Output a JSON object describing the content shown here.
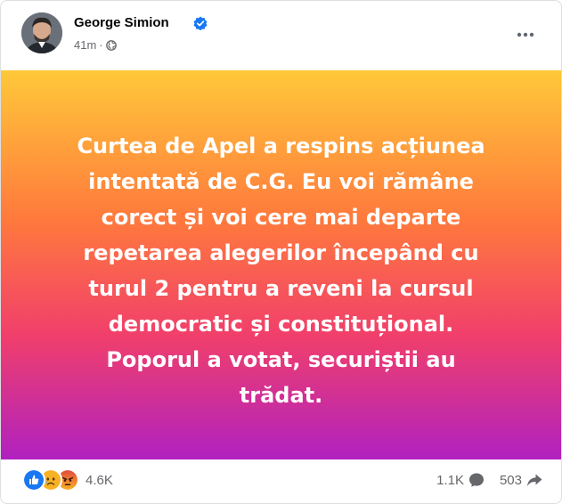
{
  "post": {
    "author": "George Simion",
    "verified": true,
    "time": "41m",
    "separator": "·",
    "privacy_icon": "globe-icon",
    "more_icon": "more-options-icon"
  },
  "banner": {
    "text": "Curtea de Apel a respins acțiunea intentată de C.G. Eu voi rămâne corect și voi cere mai departe repetarea alegerilor începând cu turul 2 pentru a reveni la cursul democratic și constituțional. Poporul a votat, securiștii au trădat.",
    "gradient": [
      "#ffc83a",
      "#ff7a3c",
      "#f13f6b",
      "#b021c0"
    ]
  },
  "footer": {
    "reactions": [
      "like-reaction-icon",
      "sad-reaction-icon",
      "angry-reaction-icon"
    ],
    "reaction_count": "4.6K",
    "comment_count": "1.1K",
    "share_count": "503"
  },
  "colors": {
    "like": "#1877f2",
    "sad": "#f7b125",
    "angry": "#e9710f",
    "muted": "#65676b"
  }
}
